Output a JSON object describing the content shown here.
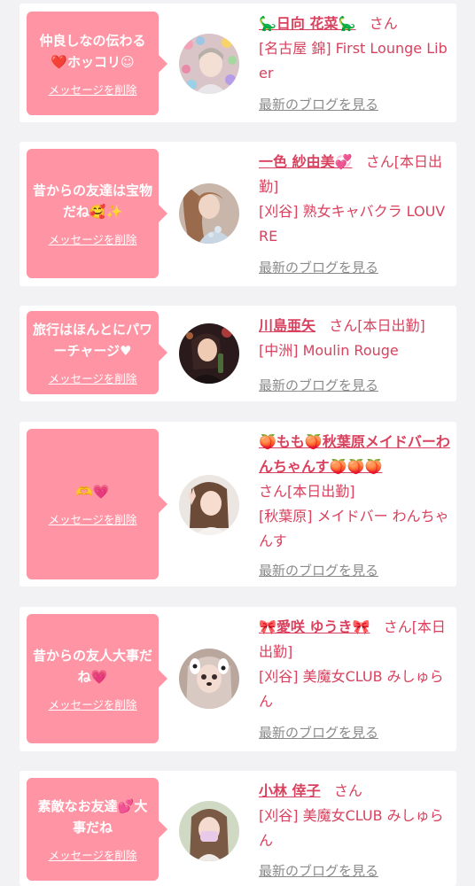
{
  "delete_label": "メッセージを削除",
  "blog_label": "最新のブログを見る",
  "colors": {
    "bubble": "#ff95a4",
    "accent": "#d9415e",
    "link_gray": "#8a8a8a",
    "background": "#f2f2f4"
  },
  "items": [
    {
      "message": "仲良しなの伝わる❤️ホッコリ☺",
      "name": "🦕日向 花菜🦕",
      "suffix": "さん",
      "shop": "[名古屋 錦] First Lounge Liber",
      "avatar_icon": "avatar-photo"
    },
    {
      "message": "昔からの友達は宝物だね🥰✨",
      "name": "一色 紗由美💞",
      "suffix": "さん[本日出勤]",
      "shop": "[刈谷] 熟女キャバクラ LOUVRE",
      "avatar_icon": "avatar-photo"
    },
    {
      "message": "旅行はほんとにパワーチャージ♥",
      "name": "川島亜矢",
      "suffix": "さん[本日出勤]",
      "shop": "[中洲] Moulin Rouge",
      "avatar_icon": "avatar-photo"
    },
    {
      "message": "🫶💗",
      "name": "🍑もも🍑秋葉原メイドバーわんちゃんす🍑🍑🍑",
      "suffix": "さん[本日出勤]",
      "shop": "[秋葉原] メイドバー わんちゃんす",
      "avatar_icon": "avatar-photo"
    },
    {
      "message": "昔からの友人大事だね💗",
      "name": "🎀愛咲 ゆうき🎀",
      "suffix": "さん[本日出勤]",
      "shop": "[刈谷] 美魔女CLUB みしゅらん",
      "avatar_icon": "avatar-photo"
    },
    {
      "message": "素敵なお友達💕大事だね",
      "name": "小林 倖子",
      "suffix": "さん",
      "shop": "[刈谷] 美魔女CLUB みしゅらん",
      "avatar_icon": "avatar-photo"
    }
  ]
}
